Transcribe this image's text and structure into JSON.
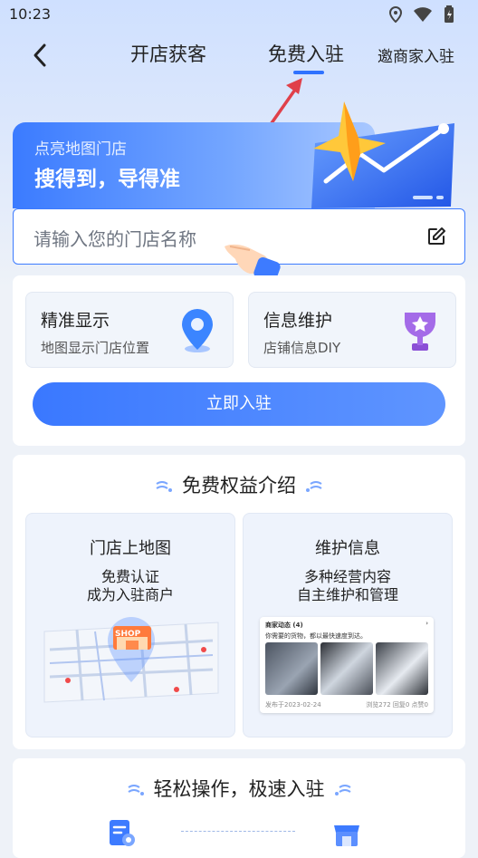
{
  "status_bar": {
    "time": "10:23",
    "icons": [
      "location-icon",
      "wifi-icon",
      "battery-icon"
    ]
  },
  "nav": {
    "tabs": [
      "开店获客",
      "免费入驻",
      "邀商家入驻"
    ],
    "active_tab": "免费入驻"
  },
  "banner": {
    "subtitle": "点亮地图门店",
    "headline": "搜得到，导得准"
  },
  "search": {
    "placeholder": "请输入您的门店名称"
  },
  "features": [
    {
      "title": "精准显示",
      "subtitle": "地图显示门店位置",
      "icon": "location-pin-icon"
    },
    {
      "title": "信息维护",
      "subtitle": "店铺信息DIY",
      "icon": "trophy-icon"
    }
  ],
  "cta": {
    "label": "立即入驻"
  },
  "benefits": {
    "title": "免费权益介绍",
    "items": [
      {
        "title": "门店上地图",
        "line1": "免费认证",
        "line2": "成为入驻商户",
        "image_text": "SHOP"
      },
      {
        "title": "维护信息",
        "line1": "多种经营内容",
        "line2": "自主维护和管理"
      }
    ],
    "news_preview": {
      "header": "商家动态 (4)",
      "desc": "你需要的货物，都以最快速度到达。",
      "date": "发布于2023-02-24",
      "stats": "浏览272  回复0  点赞0"
    }
  },
  "steps": {
    "title": "轻松操作，极速入驻",
    "icons": [
      "form-icon",
      "store-icon"
    ]
  },
  "colors": {
    "accent": "#2f72ff",
    "banner": "#3b7bff",
    "background": "#eef2f8"
  }
}
